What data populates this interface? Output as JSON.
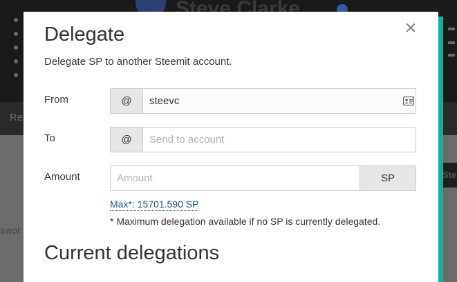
{
  "background": {
    "profile_name": "Steve Clarke",
    "nav_item": "Re",
    "side_text": "swor",
    "right_button": "Ste"
  },
  "modal": {
    "title": "Delegate",
    "subtitle": "Delegate SP to another Steemit account.",
    "close_symbol": "×",
    "from": {
      "label": "From",
      "prefix": "@",
      "value": "steevc"
    },
    "to": {
      "label": "To",
      "prefix": "@",
      "placeholder": "Send to account"
    },
    "amount": {
      "label": "Amount",
      "placeholder": "Amount",
      "unit": "SP"
    },
    "max_link": "Max*: 15701.590 SP",
    "note": "* Maximum delegation available if no SP is currently delegated.",
    "section_title": "Current delegations"
  },
  "colors": {
    "accent_green": "#0ab39b",
    "link_blue": "#1a5099"
  },
  "icons": {
    "from_field": "id-card-icon"
  }
}
